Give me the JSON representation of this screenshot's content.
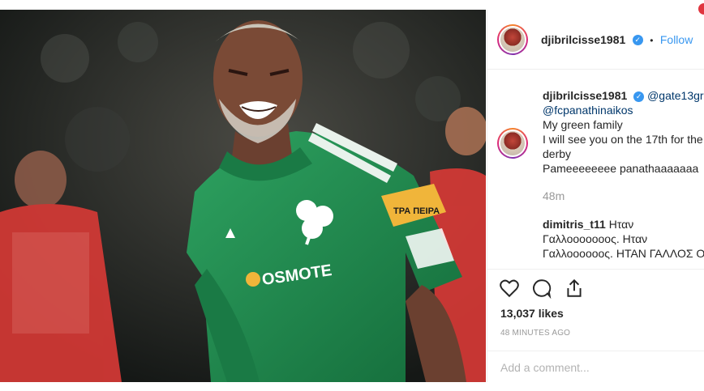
{
  "post": {
    "username": "djibrilcisse1981",
    "follow_label": "Follow",
    "separator": "•",
    "caption": {
      "mention1": "@gate13gr",
      "mention2": "@fcpanathinaikos",
      "line1": "My green family",
      "line2": "I will see you on the 17th for the",
      "line3": "derby",
      "line4": "Pameeeeeeee panathaaaaaaa",
      "time": "48m"
    },
    "comment": {
      "username": "dimitris_t11",
      "line1_text": "Ηταν",
      "line2": "Γαλλοοοοοοος. Ηταν",
      "line3": "Γαλλοοοοοος. ΗΤΑΝ ΓΑΛΛΟΣ Ο"
    },
    "likes": "13,037 likes",
    "timestamp": "48 MINUTES AGO",
    "add_comment_placeholder": "Add a comment...",
    "jersey_sponsor": "OSMOTE",
    "armband_text": "ΤΡΑ ΠΕΙΡΑ"
  },
  "icons": {
    "verified": "verified-badge-icon",
    "like": "heart-icon",
    "comment": "comment-bubble-icon",
    "share": "share-icon",
    "verified_glyph": "✓"
  },
  "colors": {
    "accent": "#3897f0",
    "mention": "#00376b",
    "jersey": "#1e8a4c",
    "opponent": "#d93a36"
  }
}
